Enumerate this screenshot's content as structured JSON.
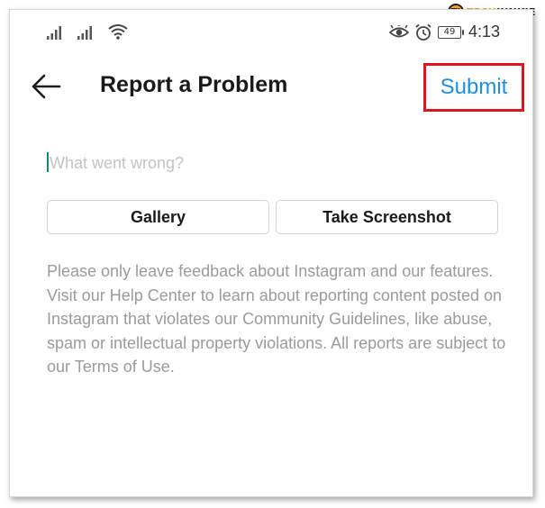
{
  "watermark": {
    "text_part1": "TECH",
    "text_part2": "JUNKIE",
    "badge": "TJ"
  },
  "status_bar": {
    "battery_level": "49",
    "time": "4:13",
    "icons": [
      "signal-icon",
      "signal-icon",
      "wifi-icon",
      "eye-icon",
      "alarm-icon",
      "battery-icon"
    ]
  },
  "header": {
    "title": "Report a Problem",
    "submit_label": "Submit",
    "highlight_color": "#e0141e",
    "accent_color": "#1e8fde"
  },
  "input": {
    "placeholder": "What went wrong?",
    "value": ""
  },
  "buttons": {
    "gallery": "Gallery",
    "screenshot": "Take Screenshot"
  },
  "info_text": "Please only leave feedback about Instagram and our features. Visit our Help Center to learn about reporting content posted on Instagram that violates our Community Guidelines, like abuse, spam or intellectual property violations. All reports are subject to our Terms of Use."
}
